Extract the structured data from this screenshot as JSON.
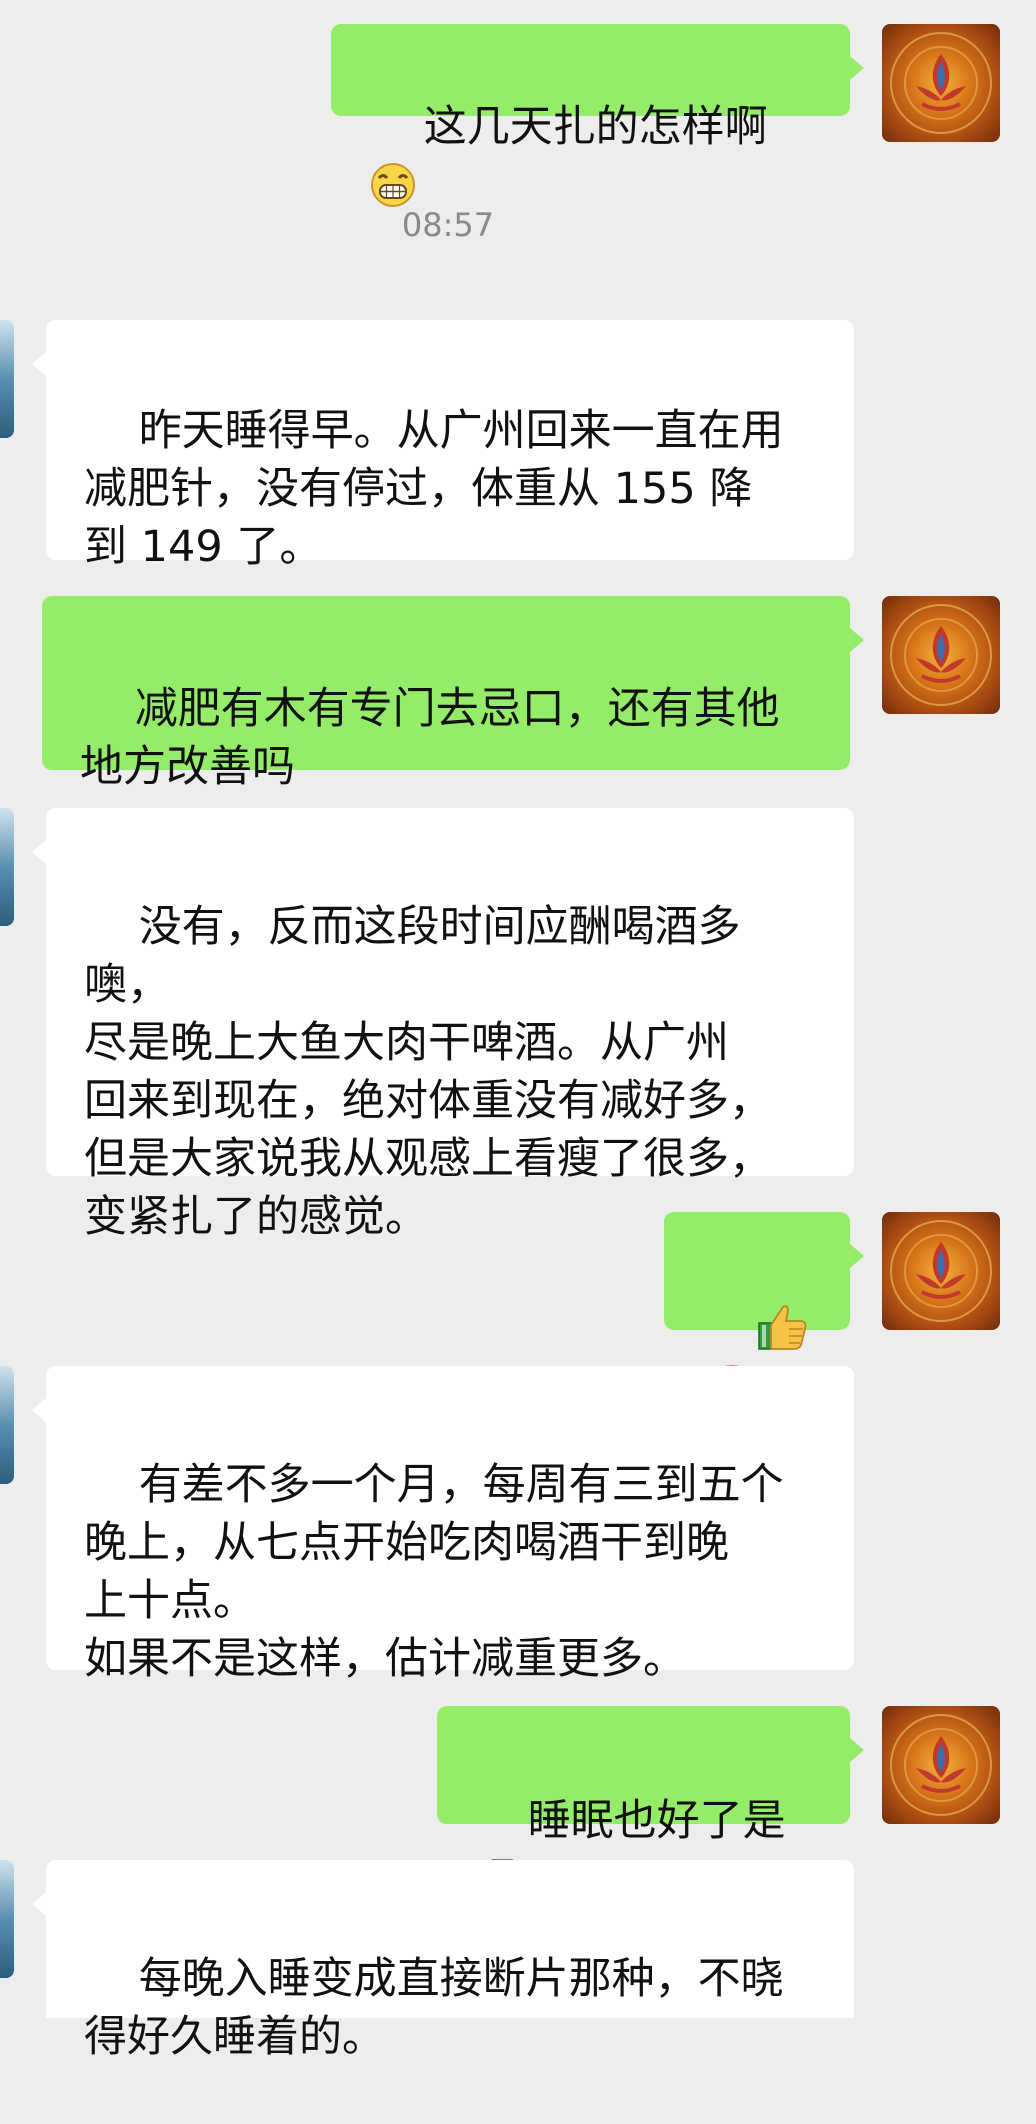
{
  "timestamp": "08:57",
  "messages": [
    {
      "id": "m1",
      "side": "out",
      "text": "这几天扎的怎样啊",
      "emoji": "grin-emoji"
    },
    {
      "id": "m2",
      "side": "in",
      "text": "昨天睡得早。从广州回来一直在用\n减肥针，没有停过，体重从 155 降\n到 149 了。"
    },
    {
      "id": "m3",
      "side": "out",
      "text": "减肥有木有专门去忌口，还有其他\n地方改善吗"
    },
    {
      "id": "m4",
      "side": "in",
      "text": "没有，反而这段时间应酬喝酒多噢，\n尽是晚上大鱼大肉干啤酒。从广州\n回来到现在，绝对体重没有减好多，\n但是大家说我从观感上看瘦了很多，\n变紧扎了的感觉。"
    },
    {
      "id": "m5",
      "side": "out",
      "text": "",
      "emoji": "thumbs-up-grin-emoji"
    },
    {
      "id": "m6",
      "side": "in",
      "text": "有差不多一个月，每周有三到五个\n晚上，从七点开始吃肉喝酒干到晚\n上十点。\n如果不是这样，估计减重更多。"
    },
    {
      "id": "m7",
      "side": "out",
      "text": "睡眠也好了是吧"
    },
    {
      "id": "m8",
      "side": "in",
      "text": "每晚入睡变成直接断片那种，不晓\n得好久睡着的。"
    }
  ],
  "colors": {
    "background": "#ededed",
    "bubble_out": "#95ec69",
    "bubble_in": "#ffffff",
    "timestamp": "#8a8a8a"
  },
  "icons": {
    "self_avatar": "lotus-avatar-icon",
    "peer_avatar": "peer-avatar-icon"
  }
}
